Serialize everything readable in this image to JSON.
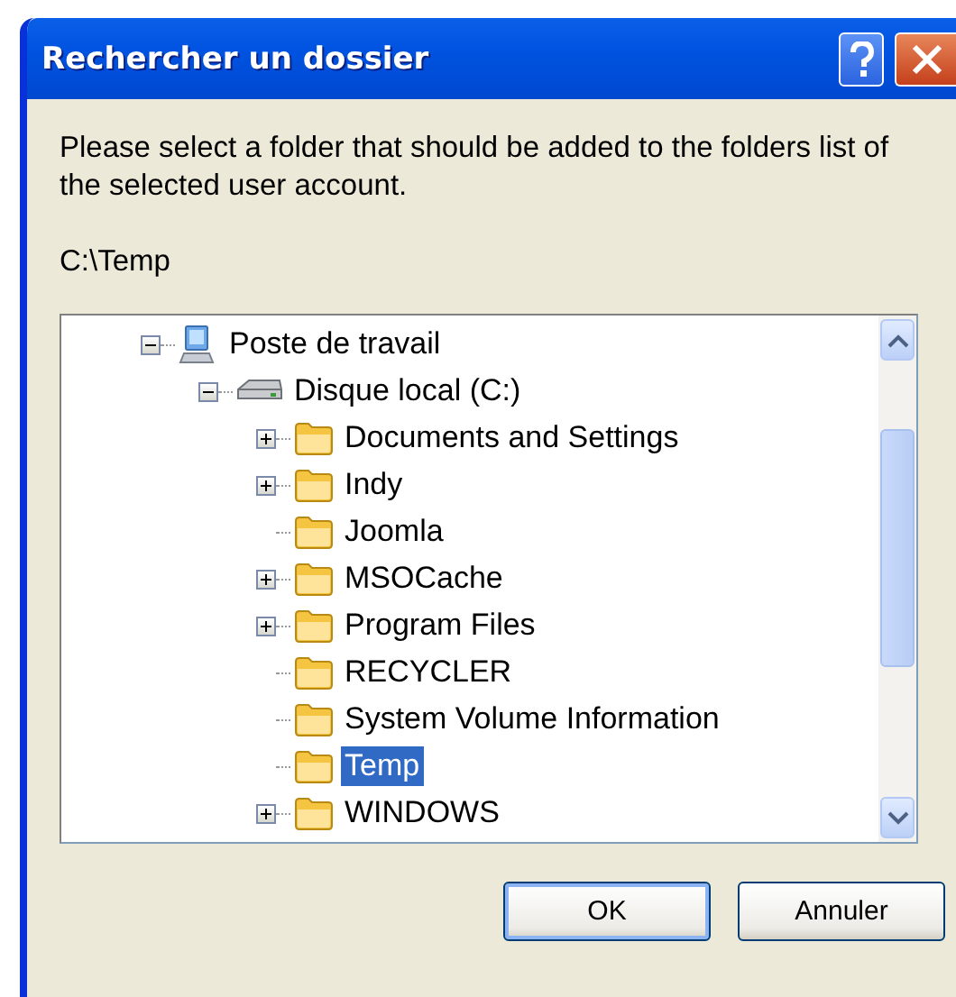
{
  "window": {
    "title": "Rechercher un dossier"
  },
  "message": "Please select a folder that should be added to the folders list of the selected user account.",
  "path": "C:\\Temp",
  "tree": [
    {
      "label": "Poste de travail",
      "kind": "computer",
      "expanded": true,
      "selected": false,
      "children": [
        {
          "label": "Disque local (C:)",
          "kind": "drive",
          "expanded": true,
          "selected": false,
          "children": [
            {
              "label": "Documents and Settings",
              "kind": "folder",
              "expanded": false,
              "selected": false
            },
            {
              "label": "Indy",
              "kind": "folder",
              "expanded": false,
              "selected": false
            },
            {
              "label": "Joomla",
              "kind": "folder",
              "selected": false
            },
            {
              "label": "MSOCache",
              "kind": "folder",
              "expanded": false,
              "selected": false
            },
            {
              "label": "Program Files",
              "kind": "folder",
              "expanded": false,
              "selected": false
            },
            {
              "label": "RECYCLER",
              "kind": "folder",
              "selected": false
            },
            {
              "label": "System Volume Information",
              "kind": "folder",
              "selected": false
            },
            {
              "label": "Temp",
              "kind": "folder",
              "selected": true
            },
            {
              "label": "WINDOWS",
              "kind": "folder",
              "expanded": false,
              "selected": false
            }
          ]
        }
      ]
    }
  ],
  "buttons": [
    {
      "label": "OK",
      "default": true
    },
    {
      "label": "Annuler",
      "default": false
    }
  ]
}
